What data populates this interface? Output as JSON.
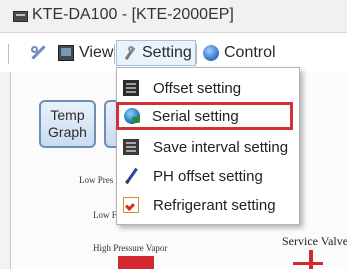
{
  "window": {
    "title": "KTE-DA100 - [KTE-2000EP]"
  },
  "menubar": {
    "items": [
      {
        "label": "View",
        "icon": "view-icon"
      },
      {
        "label": "Setting",
        "icon": "setting-icon"
      },
      {
        "label": "Control",
        "icon": "control-icon"
      }
    ]
  },
  "dropdown": {
    "items": [
      {
        "label": "Offset setting",
        "icon": "offset-icon"
      },
      {
        "label": "Serial setting",
        "icon": "serial-icon",
        "highlighted": true
      },
      {
        "label": "Save interval setting",
        "icon": "save-icon"
      },
      {
        "label": "PH offset setting",
        "icon": "pencil-icon"
      },
      {
        "label": "Refrigerant setting",
        "icon": "checkbox-icon"
      }
    ],
    "highlight_color": "#d62f36"
  },
  "content": {
    "temp_graph_button": {
      "line1": "Temp",
      "line2": "Graph"
    },
    "labels": {
      "low_pressure": "Low Pres",
      "low_f": "Low F",
      "high_pressure_vapor": "High Pressure Vapor",
      "service_valve": "Service Valve"
    }
  }
}
